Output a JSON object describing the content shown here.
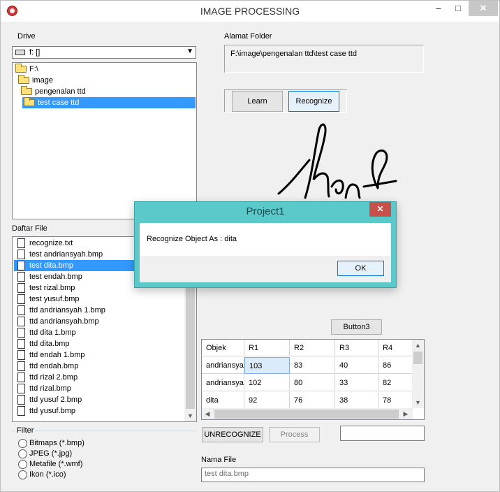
{
  "window": {
    "title": "IMAGE PROCESSING",
    "min_glyph": "–",
    "max_glyph": "□",
    "close_glyph": "✕"
  },
  "drive": {
    "label": "Drive",
    "value": "f: []"
  },
  "folders": {
    "items": [
      "F:\\",
      "image",
      "pengenalan ttd",
      "test case ttd"
    ],
    "selected": "test case ttd"
  },
  "files": {
    "label": "Daftar File",
    "items": [
      "recognize.txt",
      "test andriansyah.bmp",
      "test dita.bmp",
      "test endah.bmp",
      "test rizal.bmp",
      "test yusuf.bmp",
      "ttd andriansyah 1.bmp",
      "ttd andriansyah.bmp",
      "ttd dita 1.bmp",
      "ttd dita.bmp",
      "ttd endah 1.bmp",
      "ttd endah.bmp",
      "ttd rizal 2.bmp",
      "ttd rizal.bmp",
      "ttd yusuf 2.bmp",
      "ttd yusuf.bmp"
    ],
    "selected": "test dita.bmp"
  },
  "filter": {
    "label": "Filter",
    "options": [
      "Bitmaps (*.bmp)",
      "JPEG (*.jpg)",
      "Metafile (*.wmf)",
      "Ikon (*.ico)"
    ]
  },
  "folder_path": {
    "label": "Alamat Folder",
    "value": "F:\\image\\pengenalan ttd\\test case ttd"
  },
  "buttons": {
    "learn": "Learn",
    "recognize": "Recognize",
    "button3": "Button3",
    "unrecognize": "UNRECOGNIZE",
    "process": "Process"
  },
  "grid": {
    "headers": [
      "Objek",
      "R1",
      "R2",
      "R3",
      "R4"
    ],
    "rows": [
      [
        "andriansyah",
        "103",
        "83",
        "40",
        "86"
      ],
      [
        "andriansyah",
        "102",
        "80",
        "33",
        "82"
      ],
      [
        "dita",
        "92",
        "76",
        "38",
        "78"
      ]
    ]
  },
  "nama_file": {
    "label": "Nama File",
    "value": "test dita.bmp"
  },
  "dialog": {
    "title": "Project1",
    "message": "Recognize Object As : dita",
    "ok": "OK",
    "close_glyph": "✕"
  },
  "colors": {
    "selection": "#3399ff",
    "dialog_frame": "#5bc8c9",
    "close_red": "#c7504a"
  }
}
